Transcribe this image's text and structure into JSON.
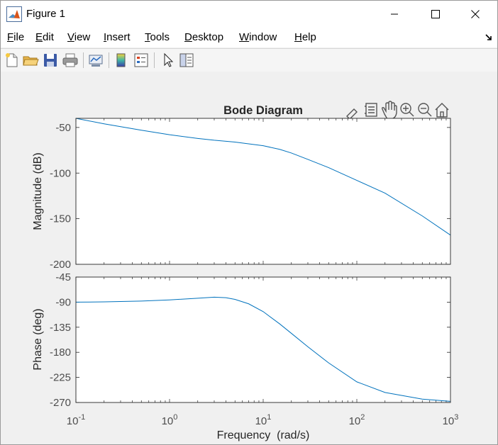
{
  "window": {
    "title": "Figure 1"
  },
  "menu": [
    {
      "label": "File",
      "mnemonic": "F"
    },
    {
      "label": "Edit",
      "mnemonic": "E"
    },
    {
      "label": "View",
      "mnemonic": "V"
    },
    {
      "label": "Insert",
      "mnemonic": "I"
    },
    {
      "label": "Tools",
      "mnemonic": "T"
    },
    {
      "label": "Desktop",
      "mnemonic": "D"
    },
    {
      "label": "Window",
      "mnemonic": "W"
    },
    {
      "label": "Help",
      "mnemonic": "H"
    }
  ],
  "toolbar": {
    "icons": [
      "new-figure-icon",
      "open-file-icon",
      "save-icon",
      "print-icon",
      "link-plot-icon",
      "insert-colorbar-icon",
      "insert-legend-icon",
      "edit-plot-arrow-icon",
      "property-inspector-icon"
    ]
  },
  "axes_toolbar": {
    "icons": [
      "brush-icon",
      "data-tips-icon",
      "pan-hand-icon",
      "zoom-in-icon",
      "zoom-out-icon",
      "restore-view-home-icon"
    ]
  },
  "colors": {
    "curve": "#0072bd",
    "axes_bg": "#ffffff",
    "figure_bg": "#f0f0f0",
    "text": "#262626"
  },
  "chart_data": {
    "type": "line",
    "title": "Bode Diagram",
    "xlabel": "Frequency  (rad/s)",
    "xscale": "log",
    "xlim": [
      0.1,
      1000
    ],
    "x_ticks": [
      {
        "value": 0.1,
        "base": "10",
        "exp": "-1"
      },
      {
        "value": 1,
        "base": "10",
        "exp": "0"
      },
      {
        "value": 10,
        "base": "10",
        "exp": "1"
      },
      {
        "value": 100,
        "base": "10",
        "exp": "2"
      },
      {
        "value": 1000,
        "base": "10",
        "exp": "3"
      }
    ],
    "panels": [
      {
        "ylabel": "Magnitude (dB)",
        "ylim": [
          -200,
          -40
        ],
        "yticks": [
          -50,
          -100,
          -150,
          -200
        ],
        "ytick_labels": [
          "-50",
          "-100",
          "-150",
          "-200"
        ],
        "x": [
          0.1,
          0.2,
          0.5,
          1,
          2,
          3,
          5,
          7,
          10,
          15,
          20,
          30,
          50,
          100,
          200,
          500,
          1000
        ],
        "y": [
          -40,
          -46,
          -53,
          -58,
          -62,
          -64,
          -66,
          -68,
          -70,
          -74,
          -78,
          -85,
          -94,
          -108,
          -122,
          -147,
          -168
        ]
      },
      {
        "ylabel": "Phase (deg)",
        "ylim": [
          -270,
          -45
        ],
        "yticks": [
          -45,
          -90,
          -135,
          -180,
          -225,
          -270
        ],
        "ytick_labels": [
          "-45",
          "-90",
          "-135",
          "-180",
          "-225",
          "-270"
        ],
        "x": [
          0.1,
          0.2,
          0.5,
          1,
          2,
          3,
          4,
          5,
          7,
          10,
          15,
          20,
          30,
          50,
          100,
          200,
          500,
          1000
        ],
        "y": [
          -90,
          -89.5,
          -88,
          -86,
          -83,
          -81,
          -82,
          -85,
          -93,
          -107,
          -129,
          -146,
          -170,
          -199,
          -233,
          -252,
          -264,
          -268
        ]
      }
    ]
  }
}
